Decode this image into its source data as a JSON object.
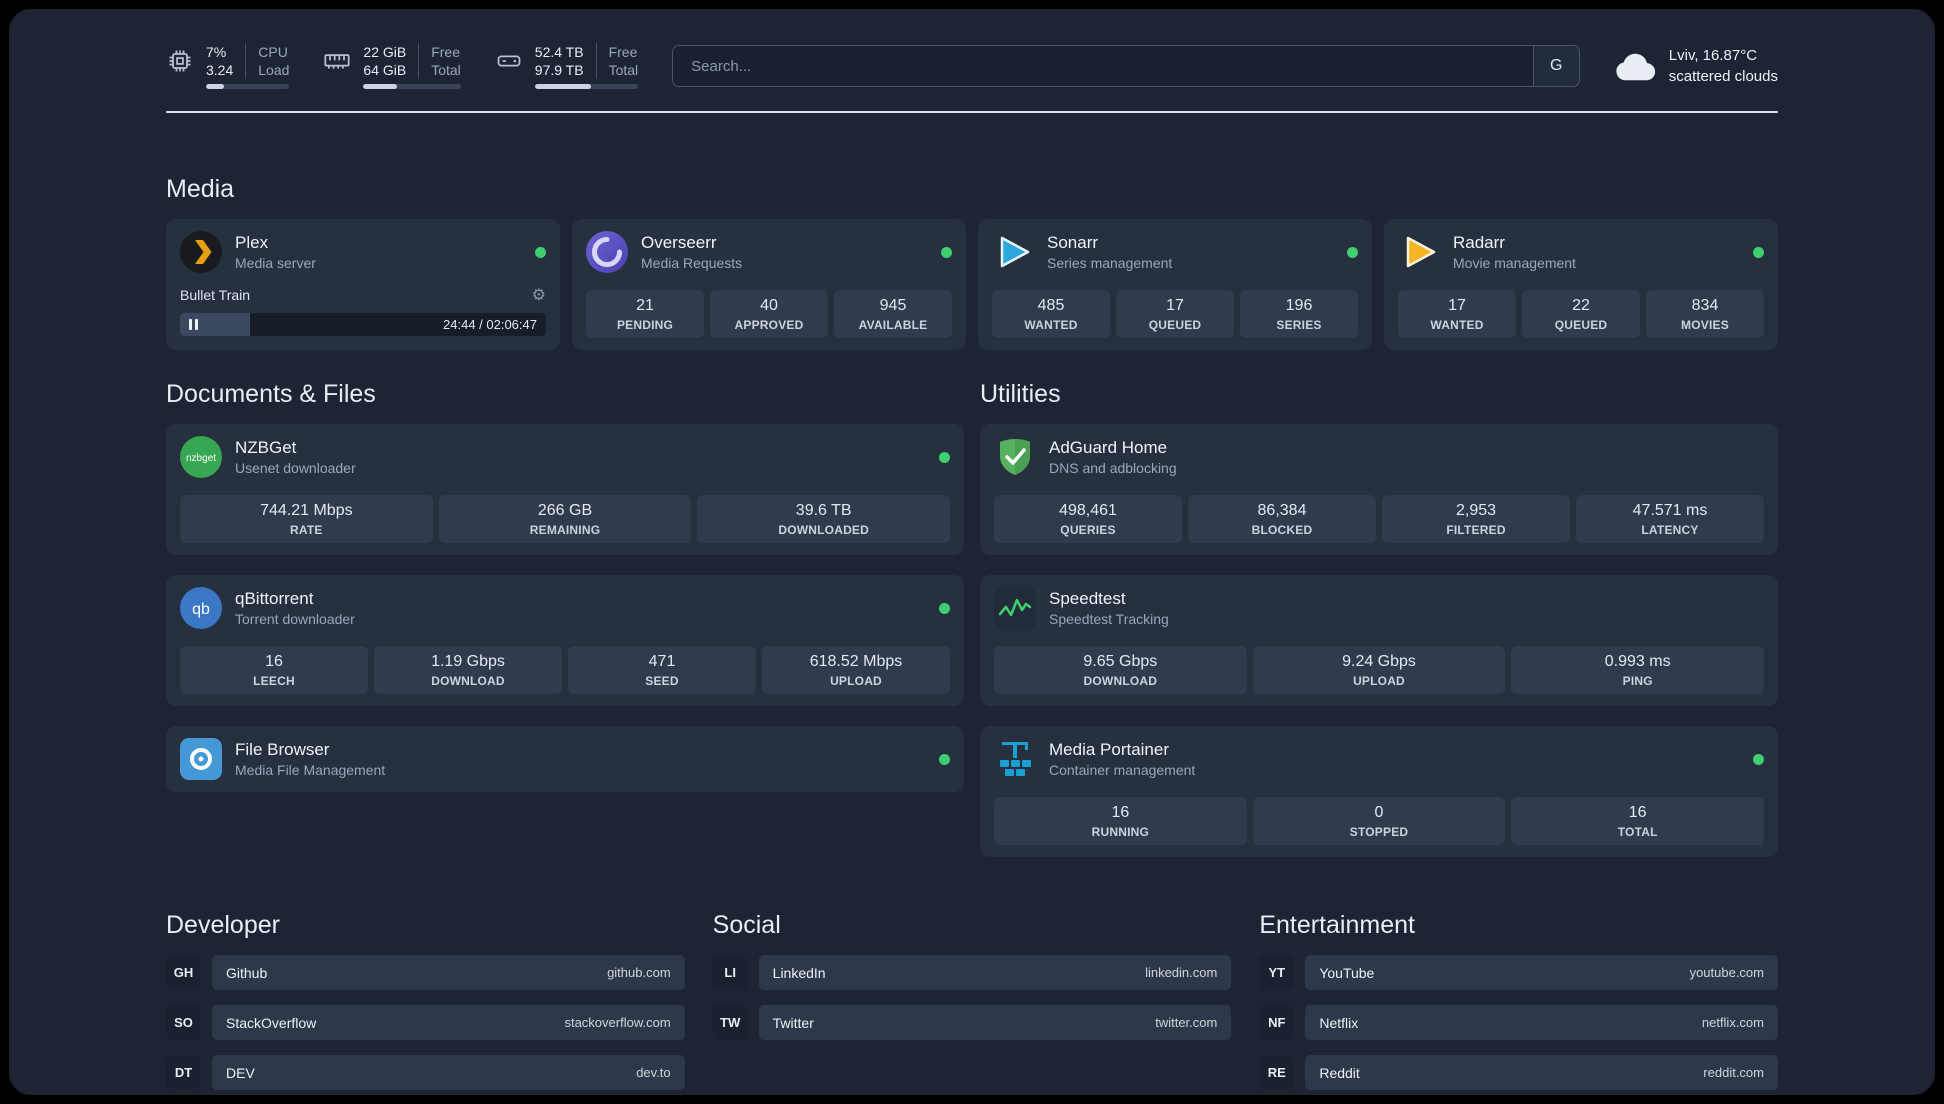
{
  "colors": {
    "page_bg": "#1d2534",
    "card_bg": "#27303f",
    "tile_bg": "#313b4e",
    "status_green": "#3ecf6e",
    "text_secondary": "#9aa6ba",
    "plex_accent": "#e5a00d",
    "sonarr_accent": "#2da8dc",
    "radarr_accent": "#f8b422",
    "adguard_accent": "#57b25f"
  },
  "icons": {
    "gear": "⚙",
    "nzbget_label": "nzbget",
    "qbittorrent_label": "qb"
  },
  "topbar": {
    "cpu": {
      "line1_value": "7%",
      "line2_value": "3.24",
      "line1_label": "CPU",
      "line2_label": "Load",
      "progress": 22
    },
    "memory": {
      "line1_value": "22 GiB",
      "line2_value": "64 GiB",
      "line1_label": "Free",
      "line2_label": "Total",
      "progress": 34
    },
    "disk": {
      "line1_value": "52.4 TB",
      "line2_value": "97.9 TB",
      "line1_label": "Free",
      "line2_label": "Total",
      "progress": 54
    },
    "search_placeholder": "Search...",
    "search_button_label": "G",
    "weather": {
      "location": "Lviv, 16.87°C",
      "condition": "scattered clouds"
    }
  },
  "sections": {
    "media": {
      "title": "Media",
      "plex": {
        "name": "Plex",
        "subtitle": "Media server",
        "now_playing": "Bullet Train",
        "time": "24:44 / 02:06:47",
        "progress": 19
      },
      "overseerr": {
        "name": "Overseerr",
        "subtitle": "Media Requests",
        "stats": [
          {
            "value": "21",
            "label": "PENDING"
          },
          {
            "value": "40",
            "label": "APPROVED"
          },
          {
            "value": "945",
            "label": "AVAILABLE"
          }
        ]
      },
      "sonarr": {
        "name": "Sonarr",
        "subtitle": "Series management",
        "stats": [
          {
            "value": "485",
            "label": "WANTED"
          },
          {
            "value": "17",
            "label": "QUEUED"
          },
          {
            "value": "196",
            "label": "SERIES"
          }
        ]
      },
      "radarr": {
        "name": "Radarr",
        "subtitle": "Movie management",
        "stats": [
          {
            "value": "17",
            "label": "WANTED"
          },
          {
            "value": "22",
            "label": "QUEUED"
          },
          {
            "value": "834",
            "label": "MOVIES"
          }
        ]
      }
    },
    "documents": {
      "title": "Documents & Files",
      "nzbget": {
        "name": "NZBGet",
        "subtitle": "Usenet downloader",
        "stats": [
          {
            "value": "744.21 Mbps",
            "label": "RATE"
          },
          {
            "value": "266 GB",
            "label": "REMAINING"
          },
          {
            "value": "39.6 TB",
            "label": "DOWNLOADED"
          }
        ]
      },
      "qbittorrent": {
        "name": "qBittorrent",
        "subtitle": "Torrent downloader",
        "stats": [
          {
            "value": "16",
            "label": "LEECH"
          },
          {
            "value": "1.19 Gbps",
            "label": "DOWNLOAD"
          },
          {
            "value": "471",
            "label": "SEED"
          },
          {
            "value": "618.52 Mbps",
            "label": "UPLOAD"
          }
        ]
      },
      "filebrowser": {
        "name": "File Browser",
        "subtitle": "Media File Management"
      }
    },
    "utilities": {
      "title": "Utilities",
      "adguard": {
        "name": "AdGuard Home",
        "subtitle": "DNS and adblocking",
        "stats": [
          {
            "value": "498,461",
            "label": "QUERIES"
          },
          {
            "value": "86,384",
            "label": "BLOCKED"
          },
          {
            "value": "2,953",
            "label": "FILTERED"
          },
          {
            "value": "47.571 ms",
            "label": "LATENCY"
          }
        ]
      },
      "speedtest": {
        "name": "Speedtest",
        "subtitle": "Speedtest Tracking",
        "stats": [
          {
            "value": "9.65 Gbps",
            "label": "DOWNLOAD"
          },
          {
            "value": "9.24 Gbps",
            "label": "UPLOAD"
          },
          {
            "value": "0.993 ms",
            "label": "PING"
          }
        ]
      },
      "portainer": {
        "name": "Media Portainer",
        "subtitle": "Container management",
        "stats": [
          {
            "value": "16",
            "label": "RUNNING"
          },
          {
            "value": "0",
            "label": "STOPPED"
          },
          {
            "value": "16",
            "label": "TOTAL"
          }
        ]
      }
    },
    "bookmarks": [
      {
        "title": "Developer",
        "items": [
          {
            "abbr": "GH",
            "name": "Github",
            "url": "github.com"
          },
          {
            "abbr": "SO",
            "name": "StackOverflow",
            "url": "stackoverflow.com"
          },
          {
            "abbr": "DT",
            "name": "DEV",
            "url": "dev.to"
          }
        ]
      },
      {
        "title": "Social",
        "items": [
          {
            "abbr": "LI",
            "name": "LinkedIn",
            "url": "linkedin.com"
          },
          {
            "abbr": "TW",
            "name": "Twitter",
            "url": "twitter.com"
          }
        ]
      },
      {
        "title": "Entertainment",
        "items": [
          {
            "abbr": "YT",
            "name": "YouTube",
            "url": "youtube.com"
          },
          {
            "abbr": "NF",
            "name": "Netflix",
            "url": "netflix.com"
          },
          {
            "abbr": "RE",
            "name": "Reddit",
            "url": "reddit.com"
          }
        ]
      }
    ]
  }
}
